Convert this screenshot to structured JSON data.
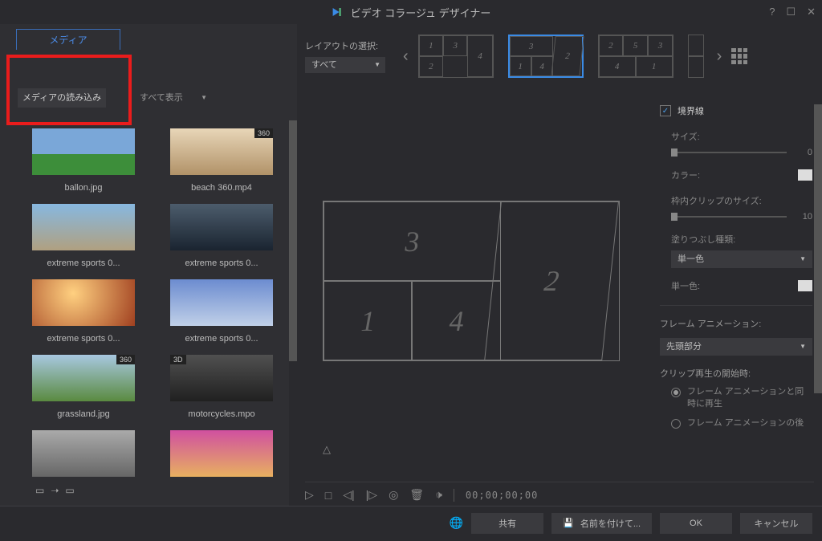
{
  "title": "ビデオ コラージュ デザイナー",
  "tabs": {
    "media": "メディア"
  },
  "import_button": "メディアの読み込み",
  "media_filter": "すべて表示",
  "media_items": [
    {
      "label": "ballon.jpg"
    },
    {
      "label": "beach 360.mp4",
      "badge": "360"
    },
    {
      "label": "extreme sports 0..."
    },
    {
      "label": "extreme sports 0..."
    },
    {
      "label": "extreme sports 0..."
    },
    {
      "label": "extreme sports 0..."
    },
    {
      "label": "grassland.jpg",
      "badge": "360"
    },
    {
      "label": "motorcycles.mpo",
      "badge3d": "3D"
    }
  ],
  "layout": {
    "label": "レイアウトの選択:",
    "filter": "すべて"
  },
  "canvas_cells": [
    "1",
    "2",
    "3",
    "4"
  ],
  "playback": {
    "timecode": "00;00;00;00"
  },
  "props": {
    "border_check": "境界線",
    "size_label": "サイズ:",
    "size_value": "0",
    "color_label": "カラー:",
    "inner_clip_label": "枠内クリップのサイズ:",
    "inner_clip_value": "10",
    "fill_type_label": "塗りつぶし種類:",
    "fill_type_value": "単一色",
    "single_color_label": "単一色:",
    "frame_anim_header": "フレーム アニメーション:",
    "frame_anim_value": "先頭部分",
    "clip_start_label": "クリップ再生の開始時:",
    "radio1": "フレーム アニメーションと同時に再生",
    "radio2": "フレーム アニメーションの後"
  },
  "bottom": {
    "share": "共有",
    "save_as": "名前を付けて...",
    "ok": "OK",
    "cancel": "キャンセル"
  }
}
